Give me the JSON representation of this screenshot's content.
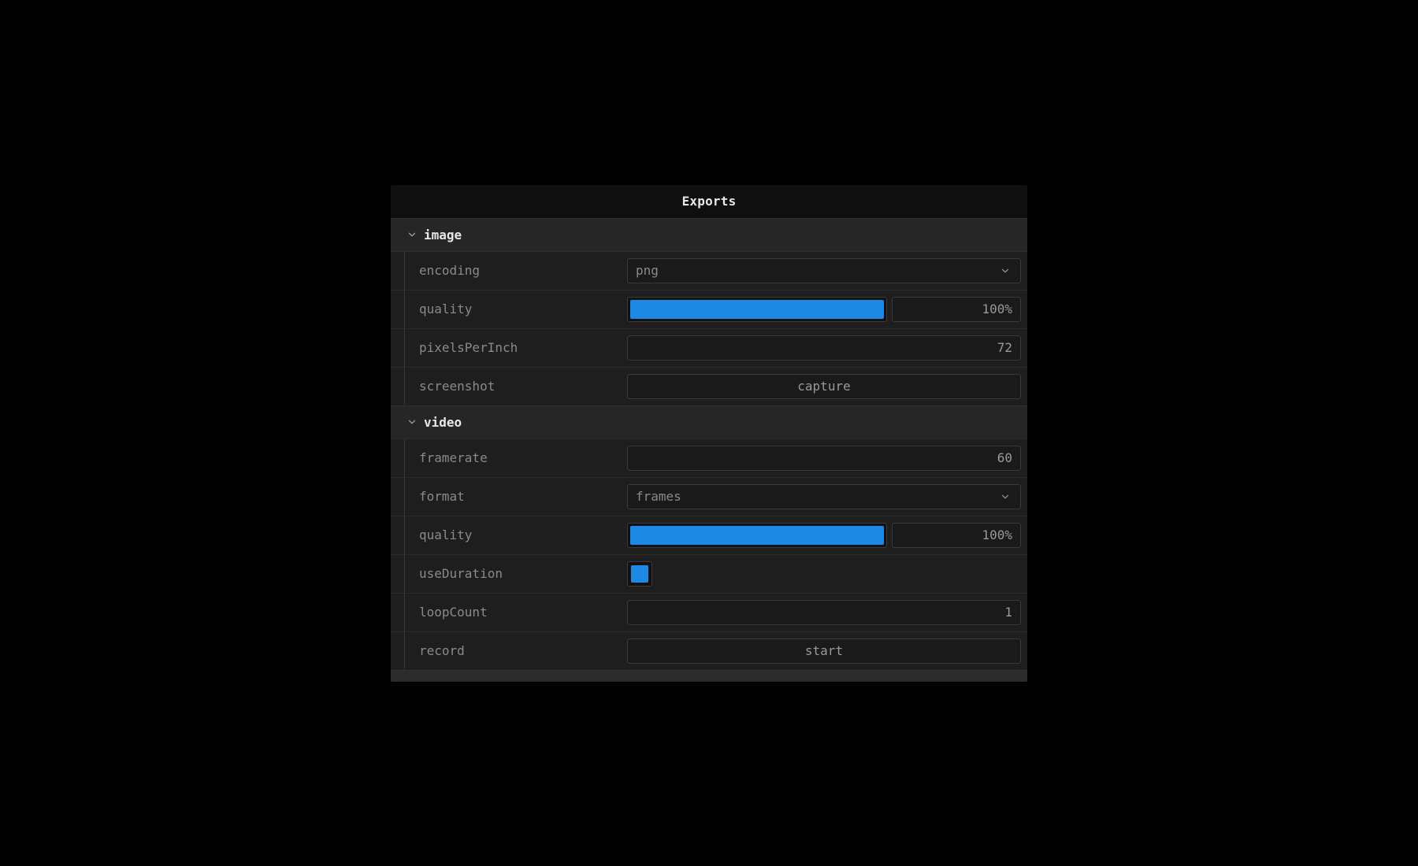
{
  "panel": {
    "title": "Exports"
  },
  "sections": {
    "image": {
      "title": "image",
      "encoding": {
        "label": "encoding",
        "value": "png"
      },
      "quality": {
        "label": "quality",
        "percent": "100%"
      },
      "pixelsPerInch": {
        "label": "pixelsPerInch",
        "value": "72"
      },
      "screenshot": {
        "label": "screenshot",
        "button": "capture"
      }
    },
    "video": {
      "title": "video",
      "framerate": {
        "label": "framerate",
        "value": "60"
      },
      "format": {
        "label": "format",
        "value": "frames"
      },
      "quality": {
        "label": "quality",
        "percent": "100%"
      },
      "useDuration": {
        "label": "useDuration",
        "checked": true
      },
      "loopCount": {
        "label": "loopCount",
        "value": "1"
      },
      "record": {
        "label": "record",
        "button": "start"
      }
    }
  }
}
